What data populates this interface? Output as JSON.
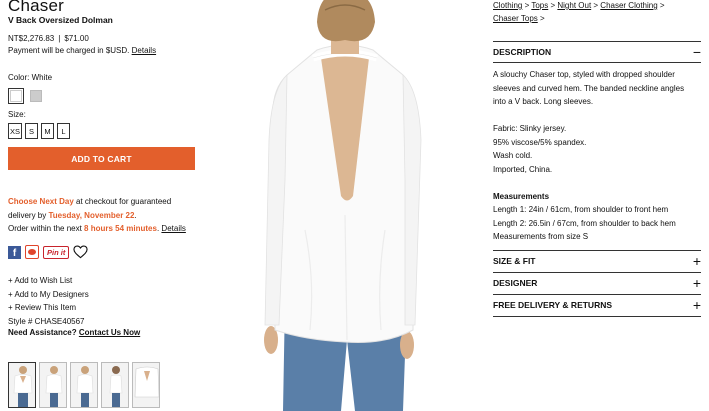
{
  "product": {
    "brand": "Chaser",
    "name": "V Back Oversized Dolman",
    "price_local": "NT$2,276.83",
    "price_usd": "$71.00",
    "payment_note": "Payment will be charged in $USD.",
    "details_link": "Details"
  },
  "options": {
    "color_label": "Color: White",
    "size_label": "Size:",
    "sizes": [
      "XS",
      "S",
      "M",
      "L"
    ]
  },
  "add_to_cart": "ADD TO CART",
  "shipping": {
    "choose": "Choose Next Day",
    "line1_rest": " at checkout for guaranteed",
    "line2_pre": "delivery by ",
    "date": "Tuesday, November 22",
    "line2_post": ".",
    "line3_pre": "Order within the next ",
    "countdown": "8 hours 54 minutes",
    "line3_post": ". ",
    "details_link": "Details"
  },
  "social": {
    "facebook_icon": "facebook-icon",
    "weibo_icon": "weibo-icon",
    "pinit_label": "Pin it",
    "heart_icon": "heart-icon"
  },
  "actions": {
    "wish_list": "+ Add to Wish List",
    "my_designers": "+ Add to My Designers",
    "review": "+ Review This Item",
    "style": "Style # CHASE40567",
    "assist_label": "Need Assistance?",
    "contact": "Contact Us Now"
  },
  "breadcrumb": {
    "clothing": "Clothing",
    "tops": "Tops",
    "night_out": "Night Out",
    "chaser_clothing": "Chaser Clothing",
    "chaser_tops": "Chaser Tops",
    "sep": " > "
  },
  "accordion": {
    "description": {
      "title": "DESCRIPTION",
      "sign": "−",
      "intro": "A slouchy Chaser top, styled with dropped shoulder sleeves and curved hem. The banded neckline angles into a V back. Long sleeves.",
      "fabric": [
        "Fabric: Slinky jersey.",
        "95% viscose/5% spandex.",
        "Wash cold.",
        "Imported, China."
      ],
      "measurements_title": "Measurements",
      "measurements": [
        "Length 1: 24in / 61cm, from shoulder to front hem",
        "Length 2: 26.5in / 67cm, from shoulder to back hem",
        "Measurements from size S"
      ]
    },
    "size_fit": {
      "title": "SIZE & FIT",
      "sign": "+"
    },
    "designer": {
      "title": "DESIGNER",
      "sign": "+"
    },
    "delivery": {
      "title": "FREE DELIVERY & RETURNS",
      "sign": "+"
    }
  },
  "colors": {
    "accent": "#e35f2c",
    "facebook": "#3b5998",
    "pinterest": "#c8232c"
  }
}
